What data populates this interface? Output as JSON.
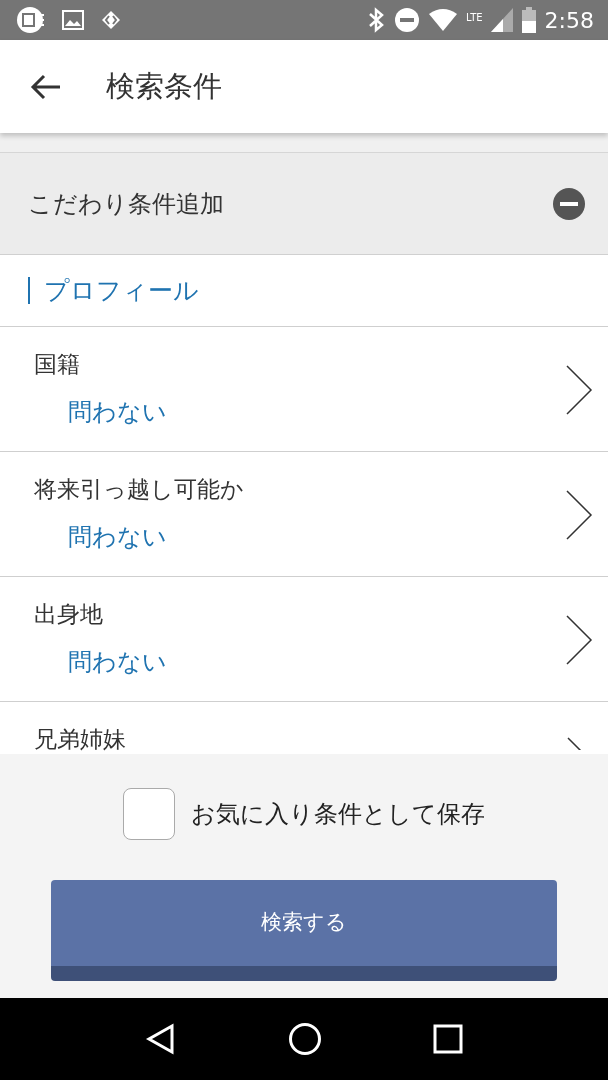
{
  "status_bar": {
    "network": "LTE",
    "time": "2:58"
  },
  "app_bar": {
    "title": "検索条件"
  },
  "section": {
    "title": "こだわり条件追加",
    "expanded": true
  },
  "group": {
    "title": "プロフィール"
  },
  "rows": [
    {
      "label": "国籍",
      "value": "問わない"
    },
    {
      "label": "将来引っ越し可能か",
      "value": "問わない"
    },
    {
      "label": "出身地",
      "value": "問わない"
    },
    {
      "label": "兄弟姉妹"
    }
  ],
  "footer": {
    "save_label": "お気に入り条件として保存",
    "checked": false,
    "search_button": "検索する"
  }
}
